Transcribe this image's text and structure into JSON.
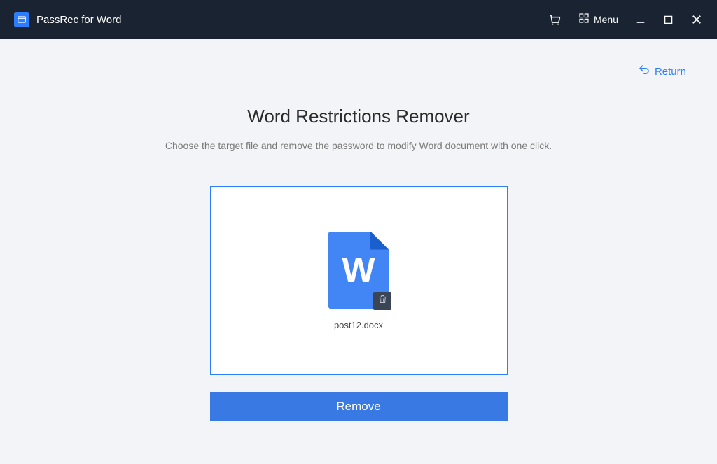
{
  "app": {
    "title": "PassRec for Word"
  },
  "titlebar": {
    "menu_label": "Menu"
  },
  "page": {
    "return_label": "Return",
    "title": "Word Restrictions Remover",
    "subtitle": "Choose the target file and remove the password to modify Word document with one click."
  },
  "file": {
    "name": "post12.docx",
    "icon_letter": "W"
  },
  "actions": {
    "remove_label": "Remove"
  },
  "colors": {
    "titlebar_bg": "#1a2332",
    "accent": "#2b7fff",
    "button": "#3979e3",
    "file_icon": "#4285f4"
  }
}
